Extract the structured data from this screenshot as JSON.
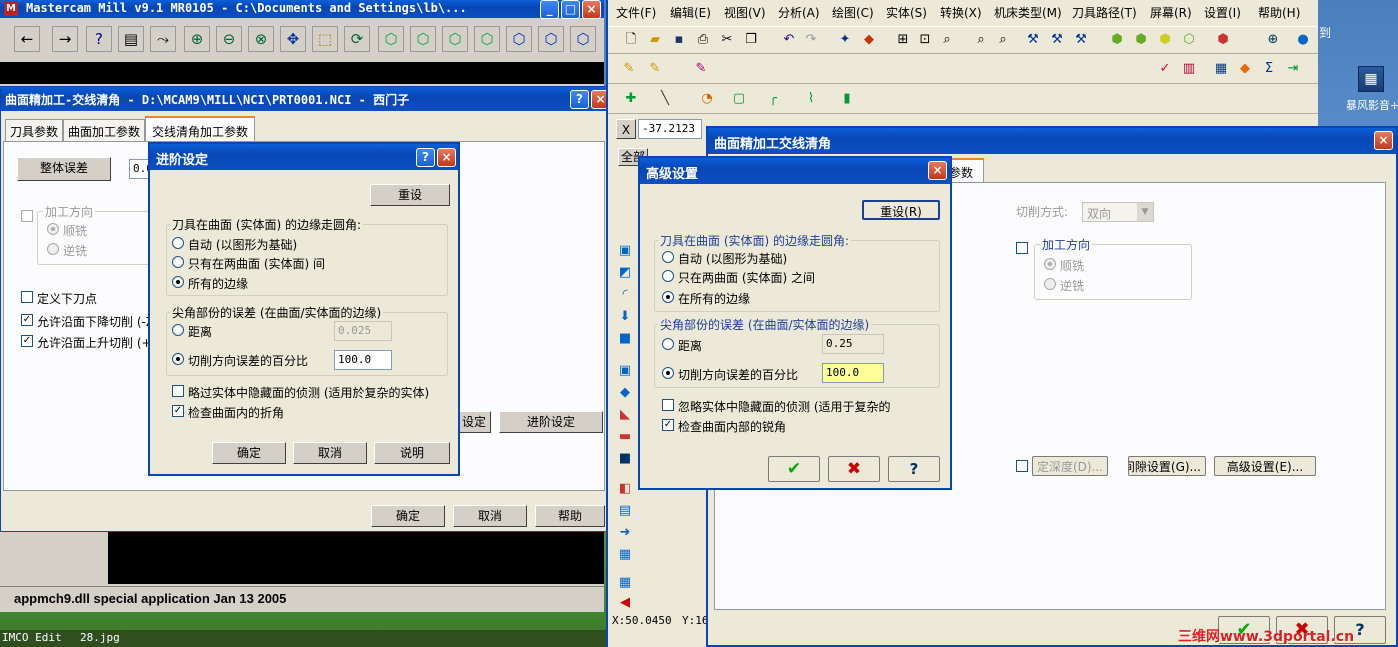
{
  "desktop": {
    "icon_label": "暴风影音+",
    "right_edge_text": "到"
  },
  "mastercam_window": {
    "title": "Mastercam Mill v9.1 MR0105 - C:\\Documents and Settings\\lb\\...",
    "status_text": "appmch9.dll special application Jan 13 2005"
  },
  "surface_dialog": {
    "title": "曲面精加工-交线清角 - D:\\MCAM9\\MILL\\NCI\\PRT0001.NCI - 西门子",
    "tabs": [
      "刀具参数",
      "曲面加工参数",
      "交线清角加工参数"
    ],
    "overall_error_button": "整体误差",
    "overall_error_value": "0.0",
    "direction_group": "加工方向",
    "climb": "顺铣",
    "conventional": "逆铣",
    "define_plunge": "定义下刀点",
    "allow_down": "允许沿面下降切削 (-Z)",
    "allow_up": "允许沿面上升切削 (+Z)",
    "left_btn_partial": "设定",
    "advanced_button": "进阶设定",
    "ok": "确定",
    "cancel": "取消",
    "help": "帮助"
  },
  "advanced_dialog_left": {
    "title": "进阶设定",
    "reset": "重设",
    "group1": "刀具在曲面 (实体面) 的边缘走圆角:",
    "opt_auto": "自动 (以图形为基础)",
    "opt_between": "只有在两曲面 (实体面) 间",
    "opt_all": "所有的边缘",
    "group2": "尖角部份的误差 (在曲面/实体面的边缘)",
    "opt_distance": "距离",
    "distance_value": "0.025",
    "opt_percent": "切削方向误差的百分比",
    "percent_value": "100.0",
    "skip_hidden": "略过实体中隐藏面的侦测 (适用於复杂的实体)",
    "check_internal": "检查曲面内的折角",
    "ok": "确定",
    "cancel": "取消",
    "help": "说明"
  },
  "mastercam_x": {
    "menu": [
      "文件(F)",
      "编辑(E)",
      "视图(V)",
      "分析(A)",
      "绘图(C)",
      "实体(S)",
      "转换(X)",
      "机床类型(M)",
      "刀具路径(T)",
      "屏幕(R)",
      "设置(I)",
      "帮助(H)"
    ],
    "coord_label": "X",
    "coord_value": "-37.2123",
    "all_button": "全部",
    "status_x": "X:50.0450",
    "status_y": "Y:16"
  },
  "surface_dialog_right": {
    "title": "曲面精加工交线清角",
    "tab_partial": "参数",
    "cut_method_label": "切削方式:",
    "cut_method_value": "双向",
    "direction_group": "加工方向",
    "climb": "顺铣",
    "conventional": "逆铣",
    "depth_btn": "定深度(D)...",
    "gap_btn": "间隙设置(G)...",
    "advanced_btn": "高级设置(E)..."
  },
  "advanced_dialog_right": {
    "title": "高级设置",
    "reset": "重设(R)",
    "group1": "刀具在曲面 (实体面) 的边缘走圆角:",
    "opt_auto": "自动 (以图形为基础)",
    "opt_between": "只在两曲面 (实体面) 之间",
    "opt_all": "在所有的边缘",
    "group2": "尖角部份的误差 (在曲面/实体面的边缘)",
    "opt_distance": "距离",
    "distance_value": "0.25",
    "opt_percent": "切削方向误差的百分比",
    "percent_value": "100.0",
    "skip_hidden": "忽略实体中隐藏面的侦测 (适用于复杂的",
    "check_internal": "检查曲面内部的锐角"
  },
  "taskbar": {
    "items": [
      "IMCO Edit",
      "28.jpg"
    ]
  },
  "watermark": "三维网www.3dportal.cn",
  "colors": {
    "xp_blue": "#0846b5",
    "dialog_bg": "#ece9d8",
    "close_red": "#c1381a",
    "highlight_field": "#ffff99"
  }
}
